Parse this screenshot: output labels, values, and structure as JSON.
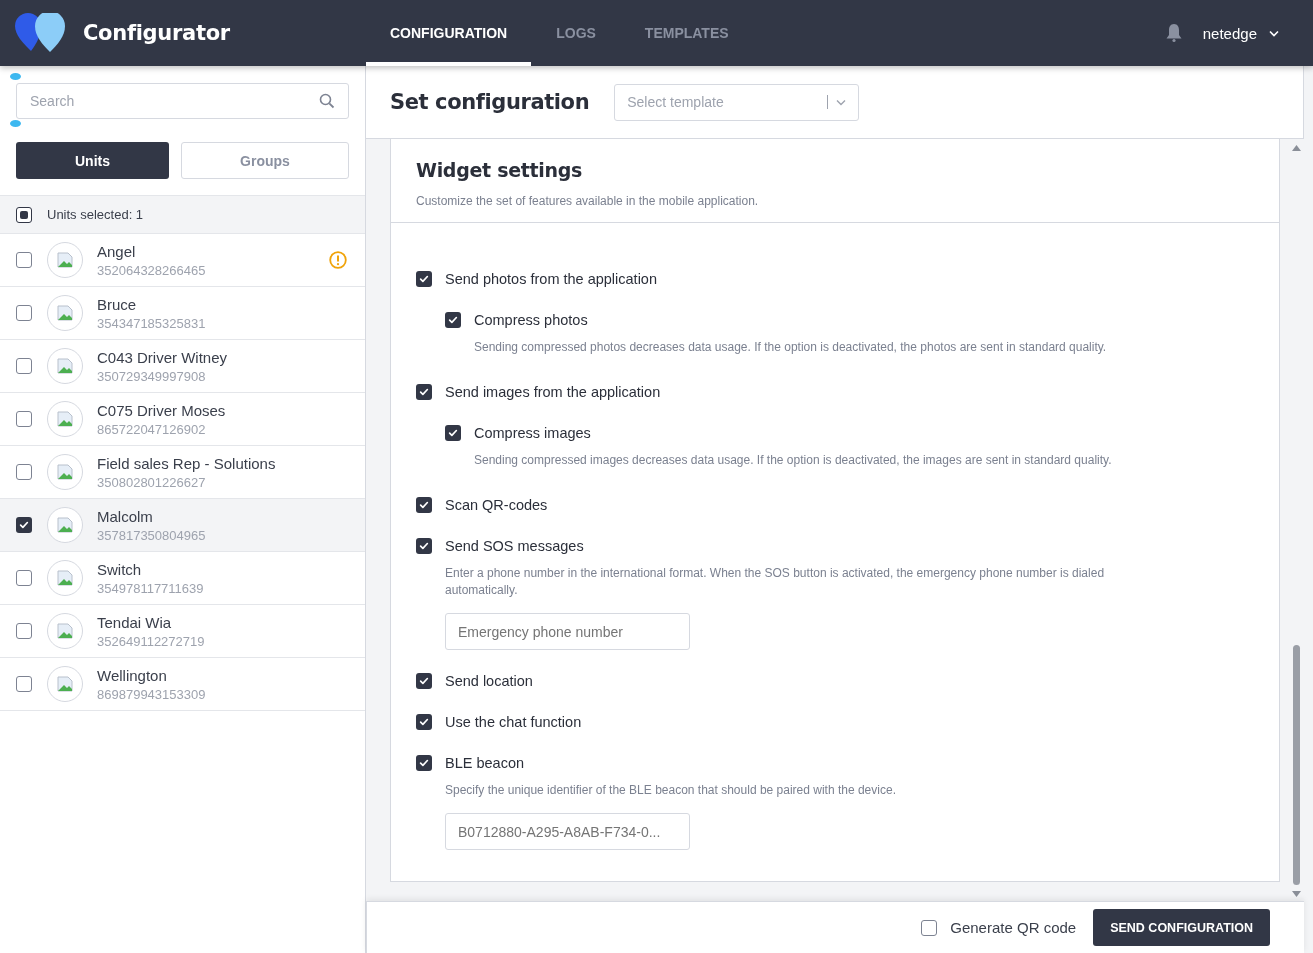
{
  "app": {
    "title": "Configurator"
  },
  "nav": [
    {
      "label": "CONFIGURATION",
      "selected": true
    },
    {
      "label": "LOGS",
      "selected": false
    },
    {
      "label": "TEMPLATES",
      "selected": false
    }
  ],
  "user": {
    "name": "netedge"
  },
  "sidebar": {
    "search": {
      "placeholder": "Search"
    },
    "segments": [
      {
        "label": "Units",
        "selected": true
      },
      {
        "label": "Groups",
        "selected": false
      }
    ],
    "selection": {
      "label": "Units selected: 1",
      "indeterminate": true
    },
    "units": [
      {
        "name": "Angel",
        "id": "352064328266465",
        "checked": false,
        "warning": true
      },
      {
        "name": "Bruce",
        "id": "354347185325831",
        "checked": false,
        "warning": false
      },
      {
        "name": "C043 Driver Witney",
        "id": "350729349997908",
        "checked": false,
        "warning": false
      },
      {
        "name": "C075 Driver Moses",
        "id": "865722047126902",
        "checked": false,
        "warning": false
      },
      {
        "name": "Field sales Rep - Solutions",
        "id": "350802801226627",
        "checked": false,
        "warning": false
      },
      {
        "name": "Malcolm",
        "id": "357817350804965",
        "checked": true,
        "warning": false
      },
      {
        "name": "Switch",
        "id": "354978117711639",
        "checked": false,
        "warning": false
      },
      {
        "name": "Tendai Wia",
        "id": "352649112272719",
        "checked": false,
        "warning": false
      },
      {
        "name": "Wellington",
        "id": "869879943153309",
        "checked": false,
        "warning": false
      }
    ]
  },
  "main": {
    "title": "Set configuration",
    "template_select": {
      "placeholder": "Select template"
    },
    "section": {
      "title": "Widget settings",
      "description": "Customize the set of features available in the mobile application.",
      "options": [
        {
          "label": "Send photos from the application",
          "checked": true,
          "children": [
            {
              "label": "Compress photos",
              "checked": true,
              "description": "Sending compressed photos decreases data usage. If the option is deactivated, the photos are sent in standard quality."
            }
          ]
        },
        {
          "label": "Send images from the application",
          "checked": true,
          "children": [
            {
              "label": "Compress images",
              "checked": true,
              "description": "Sending compressed images decreases data usage. If the option is deactivated, the images are sent in standard quality."
            }
          ]
        },
        {
          "label": "Scan QR-codes",
          "checked": true
        },
        {
          "label": "Send SOS messages",
          "checked": true,
          "description": "Enter a phone number in the international format. When the SOS button is activated, the emergency phone number is dialed automatically.",
          "field": {
            "placeholder": "Emergency phone number"
          }
        },
        {
          "label": "Send location",
          "checked": true
        },
        {
          "label": "Use the chat function",
          "checked": true
        },
        {
          "label": "BLE beacon",
          "checked": true,
          "description": "Specify the unique identifier of the BLE beacon that should be paired with the device.",
          "field": {
            "placeholder": "B0712880-A295-A8AB-F734-0..."
          }
        }
      ]
    }
  },
  "footer": {
    "qr": {
      "label": "Generate QR code",
      "checked": false
    },
    "button": "SEND CONFIGURATION"
  }
}
